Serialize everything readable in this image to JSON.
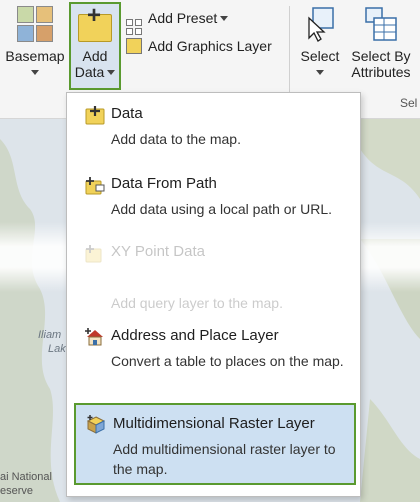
{
  "ribbon": {
    "basemap_label": "Basemap",
    "add_data_line1": "Add",
    "add_data_line2": "Data",
    "add_preset_label": "Add Preset",
    "add_graphics_layer_label": "Add Graphics Layer",
    "select_label": "Select",
    "select_by_attr_line1": "Select By",
    "select_by_attr_line2": "Attributes",
    "group_label": "Sel"
  },
  "menu": {
    "items": [
      {
        "title": "Data",
        "desc": "Add data to the map.",
        "icon": "add-data-icon"
      },
      {
        "title": "Data From Path",
        "desc": "Add data using a local path or URL.",
        "icon": "data-from-path-icon"
      },
      {
        "title": "XY Point Data",
        "desc": "",
        "icon": "xy-point-data-icon"
      },
      {
        "title": "",
        "desc": "Add query layer to the map.",
        "icon": ""
      },
      {
        "title": "Address and Place Layer",
        "desc": "Convert a table to places on the map.",
        "icon": "address-place-icon"
      },
      {
        "title": "Multidimensional Raster Layer",
        "desc": "Add multidimensional raster layer to the map.",
        "icon": "multidimensional-raster-icon"
      }
    ]
  },
  "map": {
    "label_iliamna_1": "Iliam",
    "label_iliamna_2": "Lake",
    "label_np_1": "ai National",
    "label_np_2": "eserve"
  },
  "colors": {
    "highlight_border": "#5a9a2f",
    "selected_bg": "#cde0f2",
    "folder_yellow": "#f1d25a"
  }
}
